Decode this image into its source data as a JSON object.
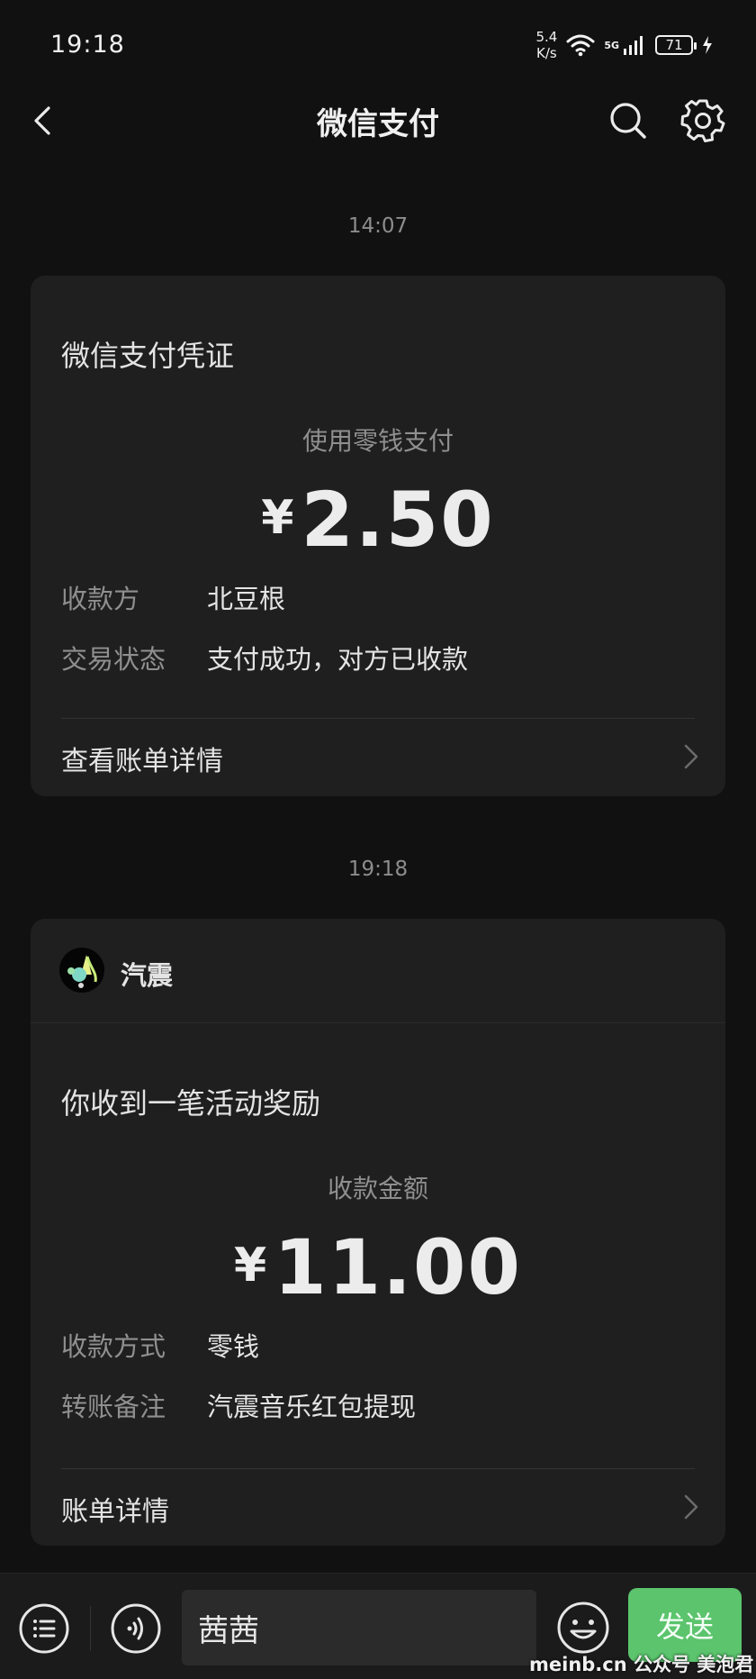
{
  "status_bar": {
    "time": "19:18",
    "net_speed_value": "5.4",
    "net_speed_unit": "K/s",
    "network": "5G",
    "battery": "71"
  },
  "nav": {
    "title": "微信支付"
  },
  "messages": [
    {
      "timestamp": "14:07",
      "card_title": "微信支付凭证",
      "subtitle": "使用零钱支付",
      "currency": "¥",
      "amount": "2.50",
      "rows": [
        {
          "label": "收款方",
          "value": "北豆根"
        },
        {
          "label": "交易状态",
          "value": "支付成功，对方已收款"
        }
      ],
      "footer": "查看账单详情"
    },
    {
      "timestamp": "19:18",
      "sender": "汽震",
      "card_title": "你收到一笔活动奖励",
      "subtitle": "收款金额",
      "currency": "¥",
      "amount": "11.00",
      "rows": [
        {
          "label": "收款方式",
          "value": "零钱"
        },
        {
          "label": "转账备注",
          "value": "汽震音乐红包提现"
        }
      ],
      "footer": "账单详情"
    }
  ],
  "input_bar": {
    "text_value": "茜茜",
    "send_label": "发送"
  },
  "watermark": "meinb.cn  公众号 美泡君",
  "colors": {
    "background": "#111111",
    "card": "#1f1f1f",
    "send_button": "#5bc46d"
  }
}
